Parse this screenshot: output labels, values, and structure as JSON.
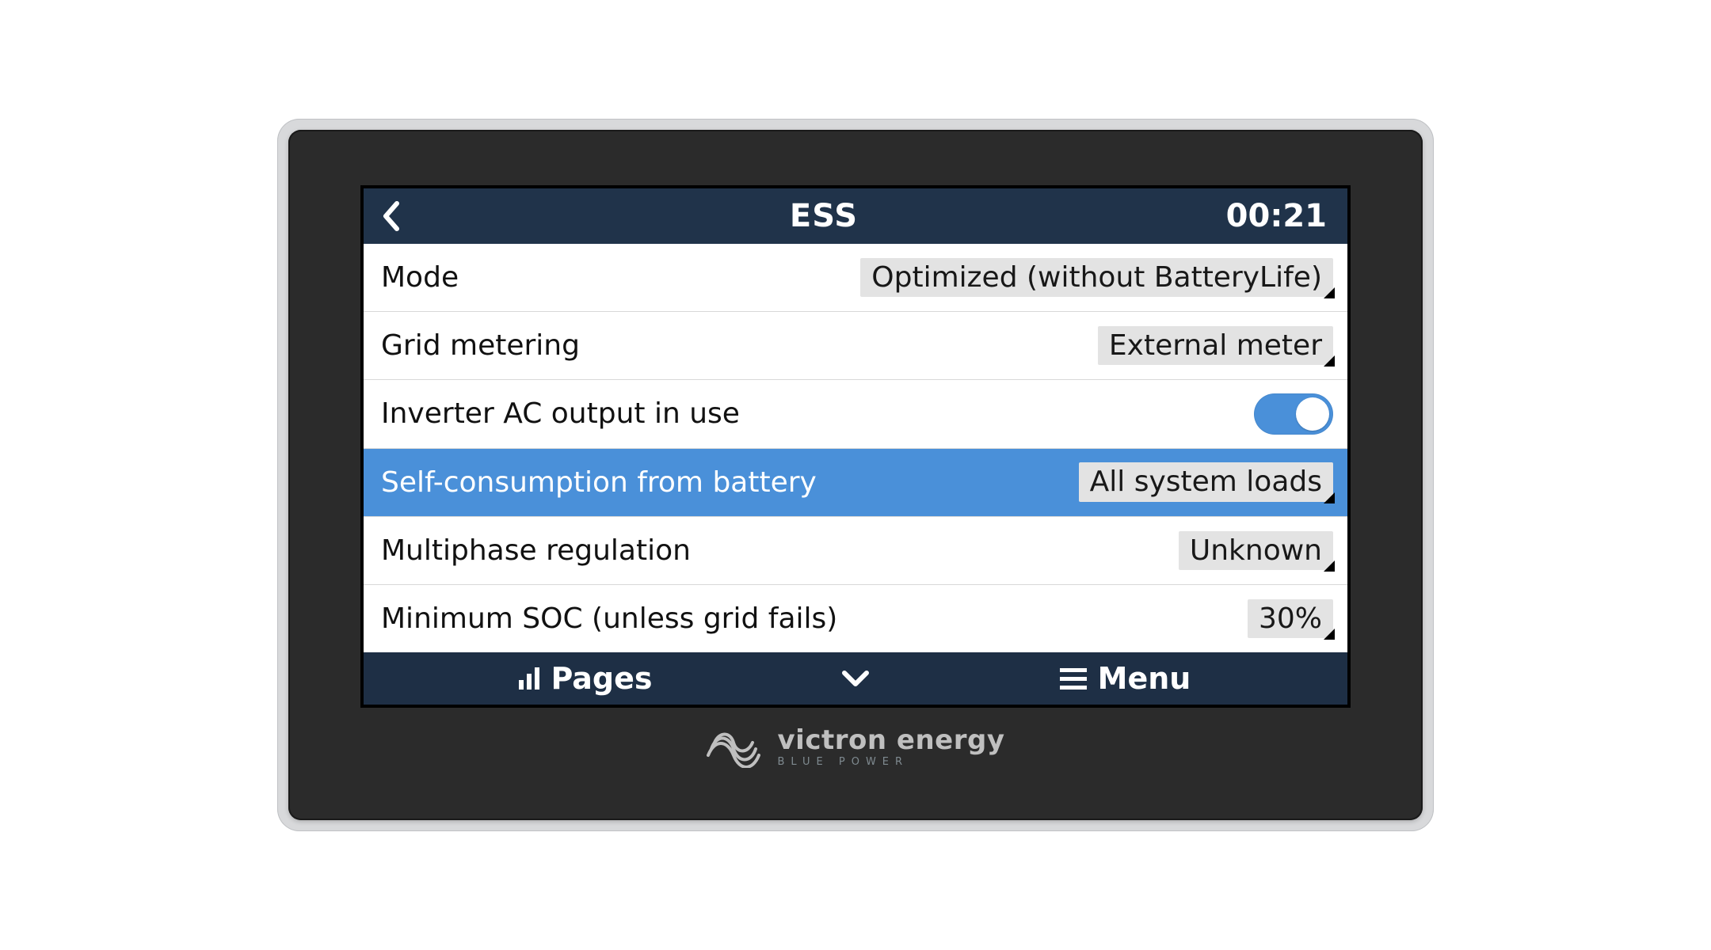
{
  "header": {
    "title": "ESS",
    "time": "00:21"
  },
  "rows": [
    {
      "label": "Mode",
      "type": "dropdown",
      "value": "Optimized (without BatteryLife)",
      "selected": false
    },
    {
      "label": "Grid metering",
      "type": "dropdown",
      "value": "External meter",
      "selected": false
    },
    {
      "label": "Inverter AC output in use",
      "type": "toggle",
      "value": true,
      "selected": false
    },
    {
      "label": "Self-consumption from battery",
      "type": "dropdown",
      "value": "All system loads",
      "selected": true
    },
    {
      "label": "Multiphase regulation",
      "type": "dropdown",
      "value": "Unknown",
      "selected": false
    },
    {
      "label": "Minimum SOC (unless grid fails)",
      "type": "dropdown",
      "value": "30%",
      "selected": false
    }
  ],
  "footer": {
    "pages_label": "Pages",
    "menu_label": "Menu"
  },
  "brand": {
    "name": "victron energy",
    "tagline": "BLUE POWER"
  }
}
